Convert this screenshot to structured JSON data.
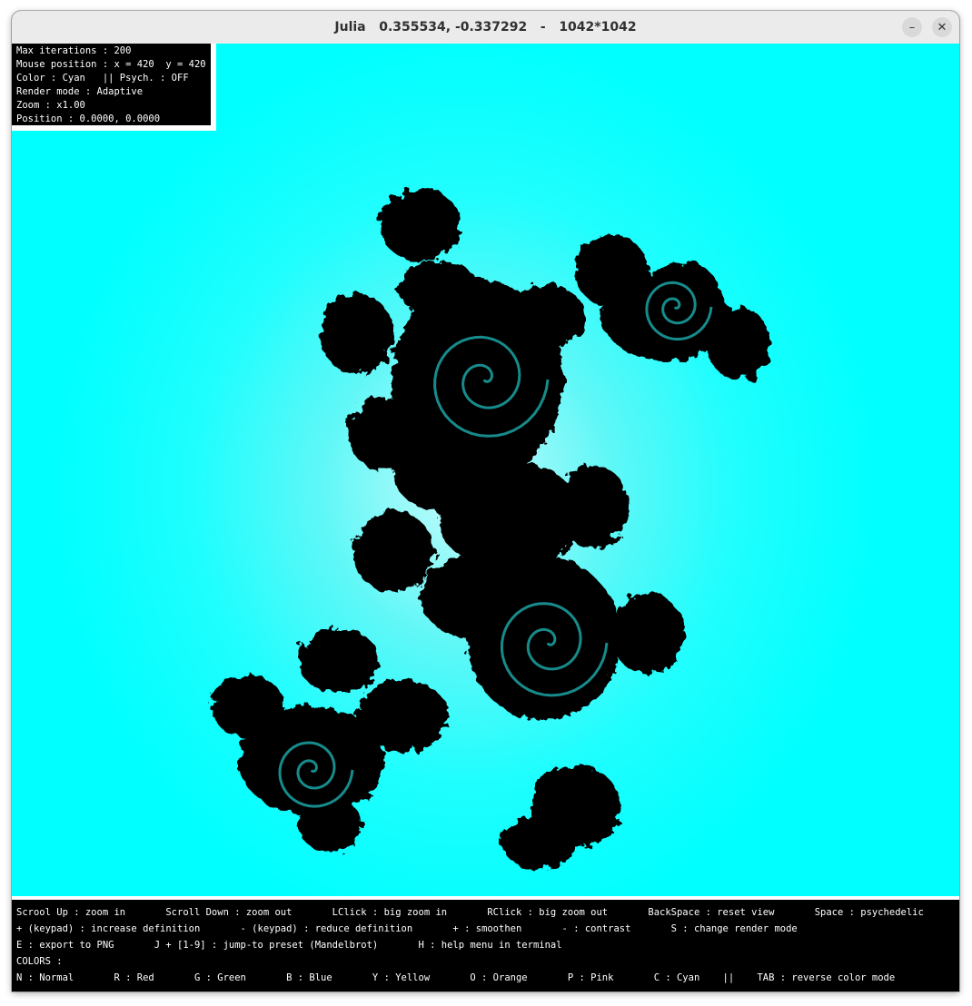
{
  "window": {
    "title": "Julia   0.355534, -0.337292   -   1042*1042",
    "minimize_icon": "minimize-icon",
    "close_icon": "close-icon",
    "minimize_glyph": "–",
    "close_glyph": "✕"
  },
  "fractal": {
    "type": "julia-set",
    "c": "0.355534, -0.337292",
    "background_color": "#00ffff",
    "set_color": "#000000",
    "edge_color": "#1a9a9a"
  },
  "info": {
    "lines": [
      "Max iterations : 200",
      "Mouse position : x = 420  y = 420",
      "Color : Cyan   || Psych. : OFF",
      "Render mode : Adaptive",
      "Zoom : x1.00",
      "Position : 0.0000, 0.0000"
    ]
  },
  "help": {
    "lines": [
      "Scrool Up : zoom in       Scroll Down : zoom out       LClick : big zoom in       RClick : big zoom out       BackSpace : reset view       Space : psychedelic",
      "+ (keypad) : increase definition       - (keypad) : reduce definition       + : smoothen       - : contrast       S : change render mode",
      "E : export to PNG       J + [1-9] : jump-to preset (Mandelbrot)       H : help menu in terminal",
      "COLORS :",
      "N : Normal       R : Red       G : Green       B : Blue       Y : Yellow       O : Orange       P : Pink       C : Cyan    ||    TAB : reverse color mode"
    ]
  }
}
